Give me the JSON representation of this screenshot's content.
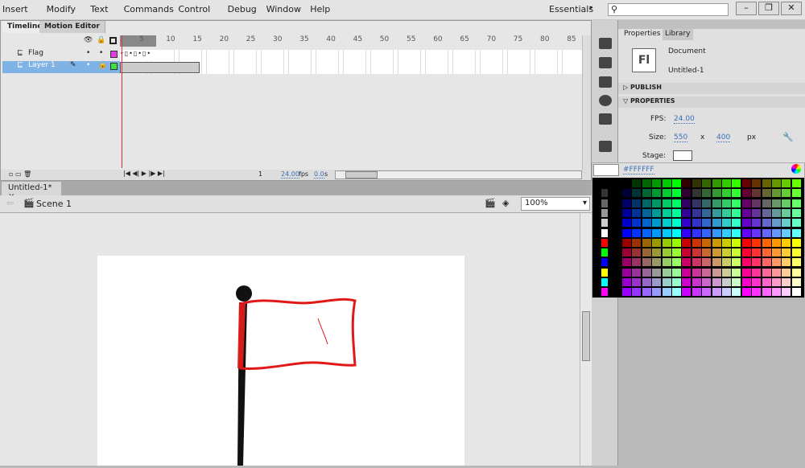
{
  "menu": [
    "Insert",
    "Modify",
    "Text",
    "Commands",
    "Control",
    "Debug",
    "Window",
    "Help"
  ],
  "workspace": "Essentials",
  "search_placeholder": "",
  "timeline": {
    "tabs": [
      "Timeline",
      "Motion Editor"
    ],
    "ruler": [
      "5",
      "10",
      "15",
      "20",
      "25",
      "30",
      "35",
      "40",
      "45",
      "50",
      "55",
      "60",
      "65",
      "70",
      "75",
      "80",
      "85"
    ],
    "layers": [
      {
        "name": "Flag",
        "color": "#e040e0",
        "selected": false
      },
      {
        "name": "Layer 1",
        "color": "#40e040",
        "selected": true
      }
    ],
    "current_frame": "1",
    "fps": "24.00",
    "fps_unit": "fps",
    "time": "0.0",
    "time_unit": "s"
  },
  "doc_tab": "Untitled-1*",
  "scene": "Scene 1",
  "zoom": "100%",
  "panel": {
    "tabs": [
      "Properties",
      "Library"
    ],
    "doc_type": "Document",
    "doc_name": "Untitled-1",
    "logo": "Fl",
    "publish": "PUBLISH",
    "properties": "PROPERTIES",
    "fps_label": "FPS:",
    "fps": "24.00",
    "size_label": "Size:",
    "width": "550",
    "x": "x",
    "height": "400",
    "unit": "px",
    "stage_label": "Stage:"
  },
  "swatch": {
    "hex": "#FFFFFF",
    "left_column": [
      "#000000",
      "#333333",
      "#666666",
      "#999999",
      "#cccccc",
      "#ffffff",
      "#ff0000",
      "#00ff00",
      "#0000ff",
      "#ffff00",
      "#00ffff",
      "#ff00ff"
    ]
  }
}
